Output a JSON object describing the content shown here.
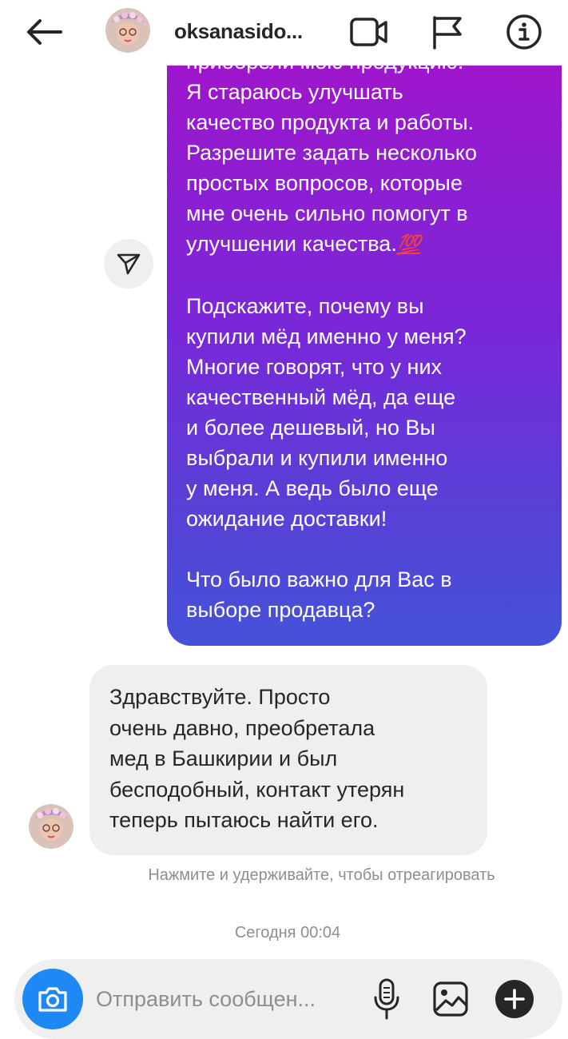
{
  "header": {
    "username": "oksanasido..."
  },
  "outgoing_message": {
    "cut_line": "приобрели мою продукцию.",
    "para1": [
      "Я стараюсь улучшать",
      "качество продукта и работы.",
      "Разрешите задать несколько",
      "простых вопросов, которые",
      "мне очень сильно помогут в",
      "улучшении качества."
    ],
    "emoji": "💯",
    "para2": [
      "Подскажите, почему вы",
      "купили мёд именно у меня?",
      "Многие говорят, что у них",
      "качественный мёд, да еще",
      "и более дешевый, но Вы",
      "выбрали и купили именно",
      "у меня. А ведь было еще",
      "ожидание доставки!"
    ],
    "para3": [
      "Что было важно для Вас в",
      "выборе продавца?"
    ]
  },
  "incoming_message": {
    "lines": [
      "Здравствуйте. Просто",
      "очень давно, преобретала",
      "мед в Башкирии и был",
      "бесподобный, контакт утерян",
      "теперь пытаюсь найти его."
    ]
  },
  "hint": "Нажмите и удерживайте, чтобы отреагировать",
  "timestamp": "Сегодня 00:04",
  "composer": {
    "placeholder": "Отправить сообщен..."
  },
  "icons": {
    "back": "arrow-left-icon",
    "video": "video-camera-icon",
    "flag": "flag-icon",
    "info": "info-icon",
    "share": "paper-plane-icon",
    "camera": "camera-icon",
    "mic": "microphone-icon",
    "gallery": "image-icon",
    "plus": "plus-icon"
  },
  "colors": {
    "accent_blue": "#1e88f5",
    "bubble_gradient_top": "#9e16cc",
    "bubble_gradient_bottom": "#4552d8",
    "incoming_bubble": "#efefef",
    "muted_text": "#8e8e8e"
  }
}
